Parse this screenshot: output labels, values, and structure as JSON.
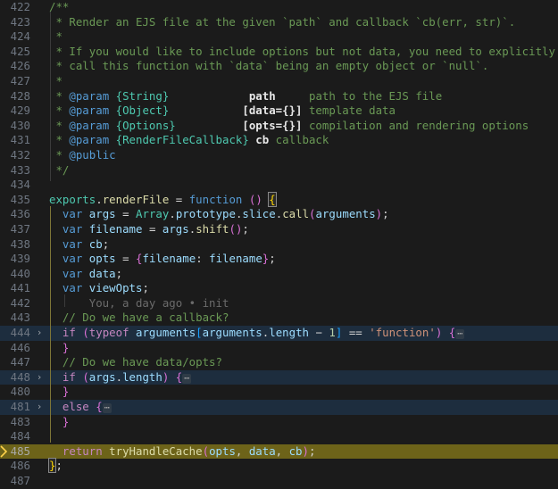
{
  "editor": {
    "theme_name": "dark-plus",
    "background": "#1b1b1b",
    "gutter_color": "#6e7681",
    "debug_line_background": "#6d6319",
    "folded_line_background": "#1d2d3e",
    "active_indent_guide": "#7e7637",
    "indent_guide": "#3b3b3b",
    "fold_chevron": "›",
    "fold_ellipsis": "⋯",
    "debug_marker": "current-execution-pointer",
    "blame_annotation": "You, a day ago • init",
    "lines": [
      {
        "num": "422",
        "state": "normal",
        "fold": "",
        "tokens": [
          {
            "t": "/**",
            "c": "cmt"
          }
        ]
      },
      {
        "num": "423",
        "state": "normal",
        "fold": "",
        "tokens": [
          {
            "t": " * Render an EJS file at the given `path` and callback `cb(err, str)`.",
            "c": "cmt"
          }
        ]
      },
      {
        "num": "424",
        "state": "normal",
        "fold": "",
        "tokens": [
          {
            "t": " *",
            "c": "cmt"
          }
        ]
      },
      {
        "num": "425",
        "state": "normal",
        "fold": "",
        "tokens": [
          {
            "t": " * If you would like to include options but not data, you need to explicitly",
            "c": "cmt"
          }
        ]
      },
      {
        "num": "426",
        "state": "normal",
        "fold": "",
        "tokens": [
          {
            "t": " * call this function with `data` being an empty object or `null`.",
            "c": "cmt"
          }
        ]
      },
      {
        "num": "427",
        "state": "normal",
        "fold": "",
        "tokens": [
          {
            "t": " *",
            "c": "cmt"
          }
        ]
      },
      {
        "num": "428",
        "state": "normal",
        "fold": "",
        "tokens": [
          {
            "t": " * ",
            "c": "cmt"
          },
          {
            "t": "@param",
            "c": "jdoc-tag"
          },
          {
            "t": " ",
            "c": "cmt"
          },
          {
            "t": "{String}",
            "c": "jdoc-type"
          },
          {
            "t": "            ",
            "c": "cmt"
          },
          {
            "t": "path",
            "c": "jdoc-name"
          },
          {
            "t": "     path to the EJS file",
            "c": "cmt"
          }
        ]
      },
      {
        "num": "429",
        "state": "normal",
        "fold": "",
        "tokens": [
          {
            "t": " * ",
            "c": "cmt"
          },
          {
            "t": "@param",
            "c": "jdoc-tag"
          },
          {
            "t": " ",
            "c": "cmt"
          },
          {
            "t": "{Object}",
            "c": "jdoc-type"
          },
          {
            "t": "           ",
            "c": "cmt"
          },
          {
            "t": "[data={}]",
            "c": "jdoc-name"
          },
          {
            "t": " template data",
            "c": "cmt"
          }
        ]
      },
      {
        "num": "430",
        "state": "normal",
        "fold": "",
        "tokens": [
          {
            "t": " * ",
            "c": "cmt"
          },
          {
            "t": "@param",
            "c": "jdoc-tag"
          },
          {
            "t": " ",
            "c": "cmt"
          },
          {
            "t": "{Options}",
            "c": "jdoc-type"
          },
          {
            "t": "          ",
            "c": "cmt"
          },
          {
            "t": "[opts={}]",
            "c": "jdoc-name"
          },
          {
            "t": " compilation and rendering options",
            "c": "cmt"
          }
        ]
      },
      {
        "num": "431",
        "state": "normal",
        "fold": "",
        "tokens": [
          {
            "t": " * ",
            "c": "cmt"
          },
          {
            "t": "@param",
            "c": "jdoc-tag"
          },
          {
            "t": " ",
            "c": "cmt"
          },
          {
            "t": "{RenderFileCallback}",
            "c": "jdoc-type"
          },
          {
            "t": " ",
            "c": "cmt"
          },
          {
            "t": "cb",
            "c": "jdoc-name"
          },
          {
            "t": " callback",
            "c": "cmt"
          }
        ]
      },
      {
        "num": "432",
        "state": "normal",
        "fold": "",
        "tokens": [
          {
            "t": " * ",
            "c": "cmt"
          },
          {
            "t": "@public",
            "c": "jdoc-tag"
          }
        ]
      },
      {
        "num": "433",
        "state": "normal",
        "fold": "",
        "tokens": [
          {
            "t": " */",
            "c": "cmt"
          }
        ]
      },
      {
        "num": "434",
        "state": "normal",
        "fold": "",
        "tokens": []
      },
      {
        "num": "435",
        "state": "normal",
        "fold": "",
        "tokens": [
          {
            "t": "exports",
            "c": "cls"
          },
          {
            "t": ".",
            "c": "op"
          },
          {
            "t": "renderFile",
            "c": "fn"
          },
          {
            "t": " ",
            "c": "op"
          },
          {
            "t": "=",
            "c": "op"
          },
          {
            "t": " ",
            "c": "op"
          },
          {
            "t": "function",
            "c": "kw2"
          },
          {
            "t": " ",
            "c": "op"
          },
          {
            "t": "()",
            "c": "punc2"
          },
          {
            "t": " ",
            "c": "op"
          },
          {
            "t": "{",
            "c": "punc bracketbox"
          }
        ]
      },
      {
        "num": "436",
        "state": "normal",
        "fold": "",
        "tokens": [
          {
            "t": "  ",
            "c": "op"
          },
          {
            "t": "var",
            "c": "kw2"
          },
          {
            "t": " ",
            "c": "op"
          },
          {
            "t": "args",
            "c": "var"
          },
          {
            "t": " ",
            "c": "op"
          },
          {
            "t": "=",
            "c": "op"
          },
          {
            "t": " ",
            "c": "op"
          },
          {
            "t": "Array",
            "c": "cls"
          },
          {
            "t": ".",
            "c": "op"
          },
          {
            "t": "prototype",
            "c": "prop"
          },
          {
            "t": ".",
            "c": "op"
          },
          {
            "t": "slice",
            "c": "prop"
          },
          {
            "t": ".",
            "c": "op"
          },
          {
            "t": "call",
            "c": "fn"
          },
          {
            "t": "(",
            "c": "punc2"
          },
          {
            "t": "arguments",
            "c": "var"
          },
          {
            "t": ")",
            "c": "punc2"
          },
          {
            "t": ";",
            "c": "op"
          }
        ]
      },
      {
        "num": "437",
        "state": "normal",
        "fold": "",
        "tokens": [
          {
            "t": "  ",
            "c": "op"
          },
          {
            "t": "var",
            "c": "kw2"
          },
          {
            "t": " ",
            "c": "op"
          },
          {
            "t": "filename",
            "c": "var"
          },
          {
            "t": " ",
            "c": "op"
          },
          {
            "t": "=",
            "c": "op"
          },
          {
            "t": " ",
            "c": "op"
          },
          {
            "t": "args",
            "c": "var"
          },
          {
            "t": ".",
            "c": "op"
          },
          {
            "t": "shift",
            "c": "fn"
          },
          {
            "t": "()",
            "c": "punc2"
          },
          {
            "t": ";",
            "c": "op"
          }
        ]
      },
      {
        "num": "438",
        "state": "normal",
        "fold": "",
        "tokens": [
          {
            "t": "  ",
            "c": "op"
          },
          {
            "t": "var",
            "c": "kw2"
          },
          {
            "t": " ",
            "c": "op"
          },
          {
            "t": "cb",
            "c": "var"
          },
          {
            "t": ";",
            "c": "op"
          }
        ]
      },
      {
        "num": "439",
        "state": "normal",
        "fold": "",
        "tokens": [
          {
            "t": "  ",
            "c": "op"
          },
          {
            "t": "var",
            "c": "kw2"
          },
          {
            "t": " ",
            "c": "op"
          },
          {
            "t": "opts",
            "c": "var"
          },
          {
            "t": " ",
            "c": "op"
          },
          {
            "t": "=",
            "c": "op"
          },
          {
            "t": " ",
            "c": "op"
          },
          {
            "t": "{",
            "c": "punc2"
          },
          {
            "t": "filename",
            "c": "var"
          },
          {
            "t": ": ",
            "c": "op"
          },
          {
            "t": "filename",
            "c": "var"
          },
          {
            "t": "}",
            "c": "punc2"
          },
          {
            "t": ";",
            "c": "op"
          }
        ]
      },
      {
        "num": "440",
        "state": "normal",
        "fold": "",
        "tokens": [
          {
            "t": "  ",
            "c": "op"
          },
          {
            "t": "var",
            "c": "kw2"
          },
          {
            "t": " ",
            "c": "op"
          },
          {
            "t": "data",
            "c": "var"
          },
          {
            "t": ";",
            "c": "op"
          }
        ]
      },
      {
        "num": "441",
        "state": "normal",
        "fold": "",
        "tokens": [
          {
            "t": "  ",
            "c": "op"
          },
          {
            "t": "var",
            "c": "kw2"
          },
          {
            "t": " ",
            "c": "op"
          },
          {
            "t": "viewOpts",
            "c": "var"
          },
          {
            "t": ";",
            "c": "op"
          }
        ]
      },
      {
        "num": "442",
        "state": "blame",
        "fold": "",
        "tokens": [
          {
            "t": "      You, a day ago • init",
            "c": "blame"
          }
        ]
      },
      {
        "num": "443",
        "state": "normal",
        "fold": "",
        "tokens": [
          {
            "t": "  // Do we have a callback?",
            "c": "cmt"
          }
        ]
      },
      {
        "num": "444",
        "state": "folded",
        "fold": "›",
        "tokens": [
          {
            "t": "  ",
            "c": "op"
          },
          {
            "t": "if",
            "c": "kw"
          },
          {
            "t": " ",
            "c": "op"
          },
          {
            "t": "(",
            "c": "punc2"
          },
          {
            "t": "typeof",
            "c": "kw"
          },
          {
            "t": " ",
            "c": "op"
          },
          {
            "t": "arguments",
            "c": "var"
          },
          {
            "t": "[",
            "c": "punc3"
          },
          {
            "t": "arguments",
            "c": "var"
          },
          {
            "t": ".",
            "c": "op"
          },
          {
            "t": "length",
            "c": "prop"
          },
          {
            "t": " ",
            "c": "op"
          },
          {
            "t": "−",
            "c": "op"
          },
          {
            "t": " ",
            "c": "op"
          },
          {
            "t": "1",
            "c": "num"
          },
          {
            "t": "]",
            "c": "punc3"
          },
          {
            "t": " ",
            "c": "op"
          },
          {
            "t": "==",
            "c": "op"
          },
          {
            "t": " ",
            "c": "op"
          },
          {
            "t": "'function'",
            "c": "str"
          },
          {
            "t": ")",
            "c": "punc2"
          },
          {
            "t": " ",
            "c": "op"
          },
          {
            "t": "{",
            "c": "punc2"
          },
          {
            "t": "⋯",
            "c": "ellip"
          }
        ]
      },
      {
        "num": "446",
        "state": "normal",
        "fold": "",
        "tokens": [
          {
            "t": "  ",
            "c": "op"
          },
          {
            "t": "}",
            "c": "punc2"
          }
        ]
      },
      {
        "num": "447",
        "state": "normal",
        "fold": "",
        "tokens": [
          {
            "t": "  // Do we have data/opts?",
            "c": "cmt"
          }
        ]
      },
      {
        "num": "448",
        "state": "folded",
        "fold": "›",
        "tokens": [
          {
            "t": "  ",
            "c": "op"
          },
          {
            "t": "if",
            "c": "kw"
          },
          {
            "t": " ",
            "c": "op"
          },
          {
            "t": "(",
            "c": "punc2"
          },
          {
            "t": "args",
            "c": "var"
          },
          {
            "t": ".",
            "c": "op"
          },
          {
            "t": "length",
            "c": "prop"
          },
          {
            "t": ")",
            "c": "punc2"
          },
          {
            "t": " ",
            "c": "op"
          },
          {
            "t": "{",
            "c": "punc2"
          },
          {
            "t": "⋯",
            "c": "ellip"
          }
        ]
      },
      {
        "num": "480",
        "state": "normal",
        "fold": "",
        "tokens": [
          {
            "t": "  ",
            "c": "op"
          },
          {
            "t": "}",
            "c": "punc2"
          }
        ]
      },
      {
        "num": "481",
        "state": "folded",
        "fold": "›",
        "tokens": [
          {
            "t": "  ",
            "c": "op"
          },
          {
            "t": "else",
            "c": "kw"
          },
          {
            "t": " ",
            "c": "op"
          },
          {
            "t": "{",
            "c": "punc2"
          },
          {
            "t": "⋯",
            "c": "ellip"
          }
        ]
      },
      {
        "num": "483",
        "state": "normal",
        "fold": "",
        "tokens": [
          {
            "t": "  ",
            "c": "op"
          },
          {
            "t": "}",
            "c": "punc2"
          }
        ]
      },
      {
        "num": "484",
        "state": "normal",
        "fold": "",
        "tokens": []
      },
      {
        "num": "485",
        "state": "debug",
        "fold": "",
        "tokens": [
          {
            "t": "  ",
            "c": "op"
          },
          {
            "t": "return",
            "c": "kw"
          },
          {
            "t": " ",
            "c": "op"
          },
          {
            "t": "tryHandleCache",
            "c": "fn"
          },
          {
            "t": "(",
            "c": "punc2"
          },
          {
            "t": "opts",
            "c": "var"
          },
          {
            "t": ", ",
            "c": "op"
          },
          {
            "t": "data",
            "c": "var"
          },
          {
            "t": ", ",
            "c": "op"
          },
          {
            "t": "cb",
            "c": "var"
          },
          {
            "t": ")",
            "c": "punc2"
          },
          {
            "t": ";",
            "c": "op"
          }
        ]
      },
      {
        "num": "486",
        "state": "normal",
        "fold": "",
        "tokens": [
          {
            "t": "}",
            "c": "punc bracketbox"
          },
          {
            "t": ";",
            "c": "op"
          }
        ]
      },
      {
        "num": "487",
        "state": "normal",
        "fold": "",
        "tokens": []
      }
    ]
  }
}
